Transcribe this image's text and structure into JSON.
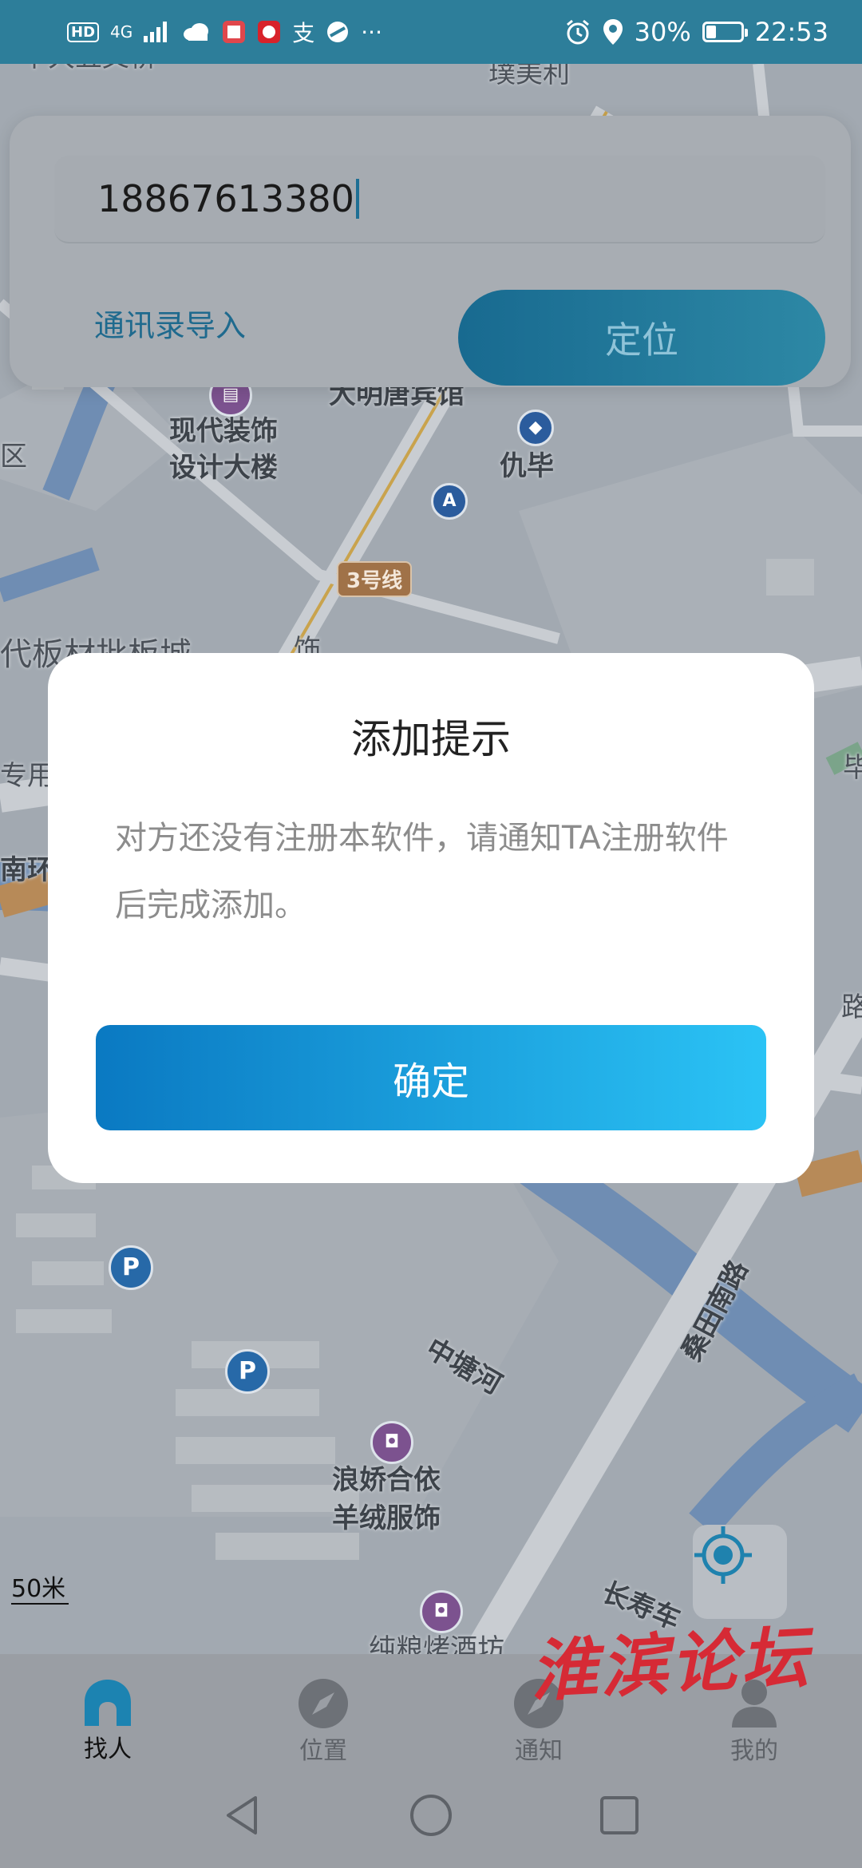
{
  "status_bar": {
    "network": "4G",
    "battery": "30%",
    "battery_level": 0.3,
    "time": "22:53",
    "more": "···"
  },
  "map": {
    "labels": {
      "top_left": "十大五叉桥",
      "top_right": "璞美利",
      "hotel": "大明唐宾馆",
      "building_l1": "现代装饰",
      "building_l2": "设计大楼",
      "station": "仇毕",
      "district": "区",
      "metro_line": "3号线",
      "market": "代板材批板城",
      "market_end": "饰",
      "special": "专用",
      "south_ring": "南环",
      "river": "中塘河",
      "road_east": "桑田南路",
      "road_south": "长寿车",
      "shop_l1": "浪娇合依",
      "shop_l2": "羊绒服饰",
      "bakery": "纯粮烤酒坊",
      "right_edge": "毕",
      "right_edge_2": "路"
    },
    "scale": "50米",
    "locate_icon": "crosshair-icon"
  },
  "search": {
    "phone_value": "18867613380",
    "import_link": "通讯录导入",
    "locate_button": "定位"
  },
  "dialog": {
    "title": "添加提示",
    "message": "对方还没有注册本软件，请通知TA注册软件后完成添加。",
    "confirm": "确定"
  },
  "bottom_nav": {
    "items": [
      {
        "label": "找人",
        "icon": "house-icon",
        "active": true
      },
      {
        "label": "位置",
        "icon": "compass-icon",
        "active": false
      },
      {
        "label": "通知",
        "icon": "compass-icon",
        "active": false
      },
      {
        "label": "我的",
        "icon": "person-icon",
        "active": false
      }
    ]
  },
  "watermark": "淮滨论坛",
  "colors": {
    "status_bar": "#2d7e9a",
    "accent": "#1f6a8e",
    "dialog_button_start": "#0a79c2",
    "dialog_button_end": "#2bc3f5"
  }
}
